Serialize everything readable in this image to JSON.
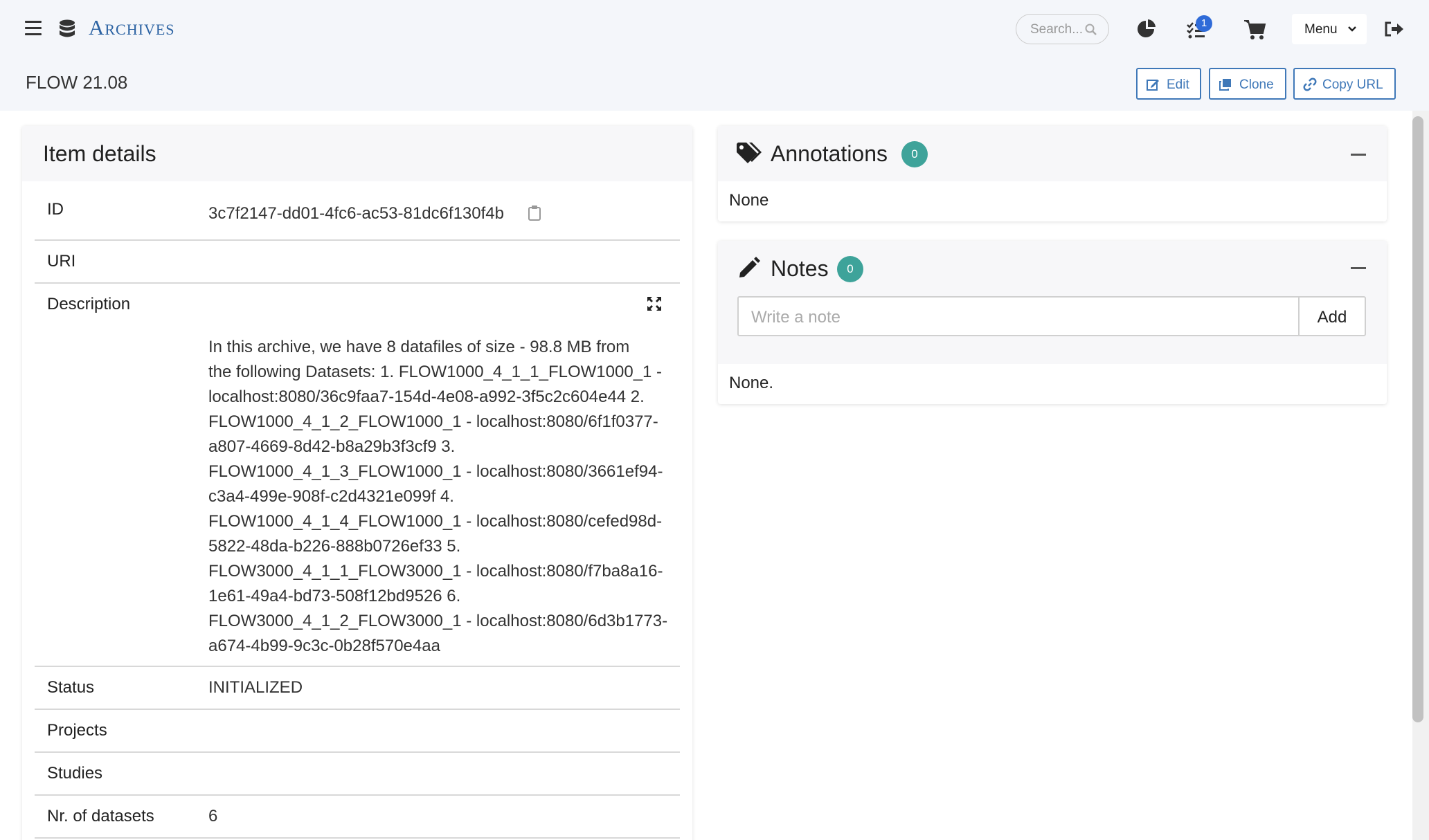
{
  "nav": {
    "brand": "Archives",
    "search_placeholder": "Search...",
    "tasks_badge": "1",
    "menu_label": "Menu",
    "icons": [
      "hamburger-icon",
      "database-icon",
      "search-icon",
      "pie-chart-icon",
      "tasks-icon",
      "cart-icon",
      "chevron-down-icon",
      "logout-icon"
    ]
  },
  "header": {
    "title": "FLOW 21.08",
    "buttons": {
      "edit": "Edit",
      "clone": "Clone",
      "copy_url": "Copy URL"
    }
  },
  "item_details": {
    "title": "Item details",
    "id_label": "ID",
    "id_value": "3c7f2147-dd01-4fc6-ac53-81dc6f130f4b",
    "uri_label": "URI",
    "description_label": "Description",
    "description_lines": [
      "In this archive, we have 8 datafiles of size - 98.8 MB from",
      "the following Datasets: 1. FLOW1000_4_1_1_FLOW1000_1 -",
      "localhost:8080/36c9faa7-154d-4e08-a992-3f5c2c604e44 2.",
      "FLOW1000_4_1_2_FLOW1000_1 - localhost:8080/6f1f0377-",
      "a807-4669-8d42-b8a29b3f3cf9 3.",
      "FLOW1000_4_1_3_FLOW1000_1 - localhost:8080/3661ef94-",
      "c3a4-499e-908f-c2d4321e099f 4.",
      "FLOW1000_4_1_4_FLOW1000_1 - localhost:8080/cefed98d-",
      "5822-48da-b226-888b0726ef33 5.",
      "FLOW3000_4_1_1_FLOW3000_1 - localhost:8080/f7ba8a16-",
      "1e61-49a4-bd73-508f12bd9526 6.",
      "FLOW3000_4_1_2_FLOW3000_1 - localhost:8080/6d3b1773-",
      "a674-4b99-9c3c-0b28f570e4aa"
    ],
    "status_label": "Status",
    "status_value": "INITIALIZED",
    "projects_label": "Projects",
    "studies_label": "Studies",
    "datasets_label": "Nr. of datasets",
    "datasets_value": "6"
  },
  "annotations": {
    "title": "Annotations",
    "count": "0",
    "empty_text": "None"
  },
  "notes": {
    "title": "Notes",
    "count": "0",
    "input_placeholder": "Write a note",
    "add_label": "Add",
    "empty_text": "None."
  },
  "colors": {
    "brand": "#2c63a3",
    "accent": "#3f78b8",
    "badge_teal": "#3ea39a",
    "badge_blue": "#2f6bd8"
  }
}
